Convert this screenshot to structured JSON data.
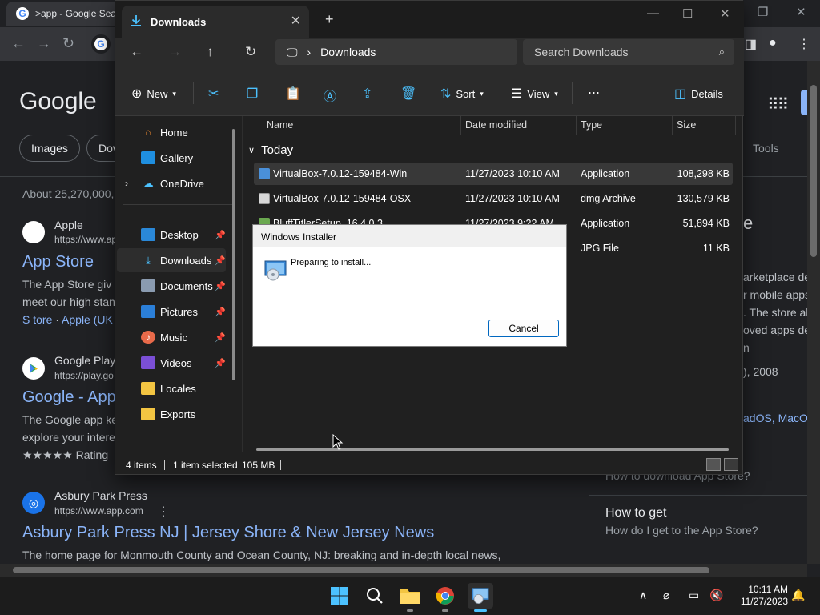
{
  "chrome": {
    "tab_title": ">app - Google Search",
    "result_stats": "About 25,270,000,"
  },
  "google": {
    "logo": "Google",
    "filters": [
      "Images",
      "Dov"
    ],
    "tools": "Tools",
    "results": [
      {
        "site": "Apple",
        "url": "https://www.ap",
        "title": "App Store",
        "snippet_lines": [
          "The App Store giv",
          "meet our high stan"
        ],
        "sublinks": [
          "S tore",
          "Apple (UK"
        ]
      },
      {
        "site": "Google Play",
        "url": "https://play.go",
        "title": "Google - App",
        "snippet_lines": [
          "The Google app ke",
          "explore your intere"
        ],
        "rating_text": "★★★★★ Rating"
      },
      {
        "site": "Asbury Park Press",
        "url": "https://www.app.com",
        "title": "Asbury Park Press NJ | Jersey Shore & New Jersey News",
        "snippet_lines": [
          "The home page for Monmouth County and Ocean County, NJ: breaking and in-depth local news,"
        ]
      }
    ],
    "knowledge_panel": {
      "heading_fragment": "e",
      "lines": [
        "arketplace de",
        "r mobile apps",
        ". The store all",
        "oved apps de",
        "n"
      ],
      "date_fragment": "), 2008",
      "platforms": "adOS, MacO",
      "faq": [
        {
          "question": "",
          "answer": "How to download App Store?"
        },
        {
          "question": "How to get",
          "answer": "How do I get to the App Store?"
        }
      ]
    }
  },
  "explorer": {
    "tab_title": "Downloads",
    "breadcrumb": "Downloads",
    "search_placeholder": "Search Downloads",
    "toolbar": {
      "new_label": "New",
      "sort_label": "Sort",
      "view_label": "View",
      "more_label": "...",
      "details_label": "Details"
    },
    "sidebar": {
      "home": "Home",
      "gallery": "Gallery",
      "onedrive": "OneDrive",
      "desktop": "Desktop",
      "downloads": "Downloads",
      "documents": "Documents",
      "pictures": "Pictures",
      "music": "Music",
      "videos": "Videos",
      "locales": "Locales",
      "exports": "Exports"
    },
    "columns": {
      "name": "Name",
      "date": "Date modified",
      "type": "Type",
      "size": "Size"
    },
    "group": "Today",
    "files": [
      {
        "name": "VirtualBox-7.0.12-159484-Win",
        "date": "11/27/2023 10:10 AM",
        "type": "Application",
        "size": "108,298 KB"
      },
      {
        "name": "VirtualBox-7.0.12-159484-OSX",
        "date": "11/27/2023 10:10 AM",
        "type": "dmg Archive",
        "size": "130,579 KB"
      },
      {
        "name": "BluffTitlerSetup_16.4.0.3",
        "date": "11/27/2023 9:22 AM",
        "type": "Application",
        "size": "51,894 KB"
      },
      {
        "name": "",
        "date": "",
        "type": "JPG File",
        "size": "11 KB"
      }
    ],
    "status": {
      "items": "4 items",
      "selected": "1 item selected",
      "size": "105 MB"
    }
  },
  "installer": {
    "title": "Windows Installer",
    "message": "Preparing to install...",
    "cancel_label": "Cancel"
  },
  "taskbar": {
    "time": "10:11 AM",
    "date": "11/27/2023"
  },
  "colors": {
    "accent": "#4cc2ff",
    "link": "#8ab4f8",
    "folder": "#f3c542"
  }
}
